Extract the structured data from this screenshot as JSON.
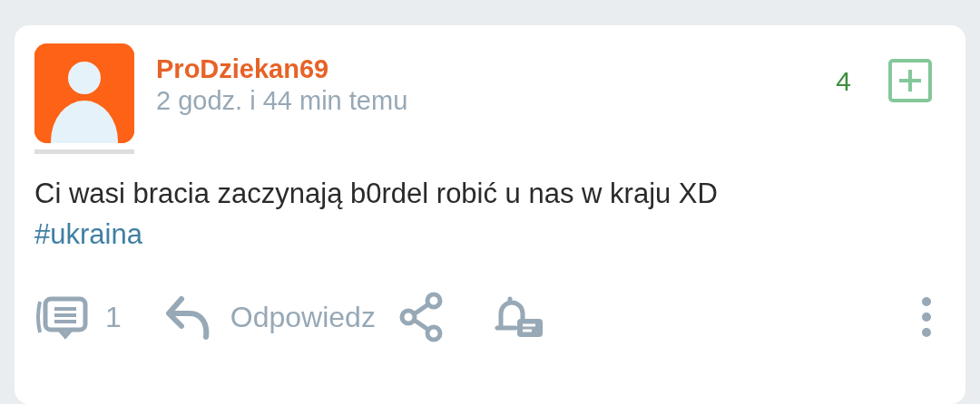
{
  "post": {
    "author": "ProDziekan69",
    "time": "2 godz. i 44 min temu",
    "votes": "4",
    "body": "Ci wasi bracia zaczynają b0rdel robić u nas w kraju XD",
    "tag": "#ukraina",
    "comments": "1",
    "reply": "Odpowiedz"
  }
}
